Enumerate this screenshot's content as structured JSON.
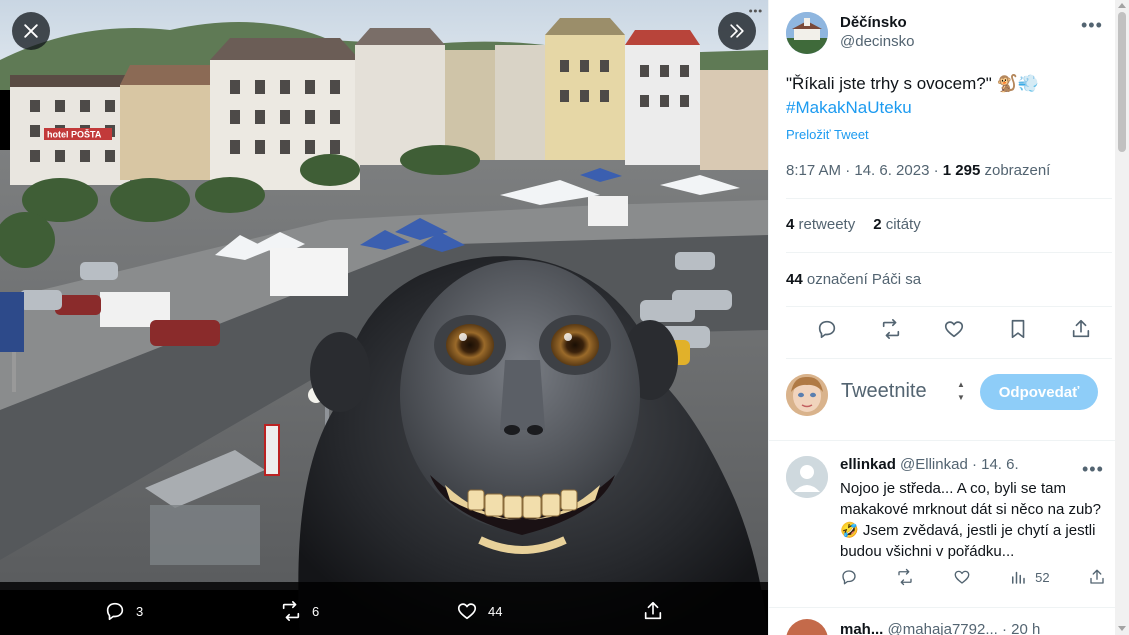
{
  "media": {
    "actions": {
      "replies": "3",
      "retweets": "6",
      "likes": "44"
    },
    "icons": [
      "close-icon",
      "double-chevron-right-icon",
      "reply-icon",
      "retweet-icon",
      "like-icon",
      "share-icon"
    ],
    "signs": {
      "hotel": "hotel POŠTA"
    }
  },
  "tweet": {
    "author_name": "Děčínsko",
    "author_handle": "@decinsko",
    "text": "\"Říkali jste trhy s ovocem?\" 🐒💨",
    "hashtag": "#MakakNaUteku",
    "translate": "Preložiť Tweet",
    "time": "8:17 AM · 14. 6. 2023 · ",
    "views_count": "1 295",
    "views_label": " zobrazení",
    "retweets_count": "4",
    "retweets_label": " retweety",
    "quotes_count": "2",
    "quotes_label": " citáty",
    "likes_count": "44",
    "likes_label": " označení Páči sa"
  },
  "reply_box": {
    "placeholder": "Tweetnite",
    "button": "Odpovedať"
  },
  "replies": [
    {
      "name": "ellinkad",
      "handle": "@Ellinkad",
      "date": " · 14. 6.",
      "text": "Nojoo je středa... A co, byli se tam makakové mrknout dát si něco na zub? 🤣 Jsem zvědavá, jestli je chytí a jestli budou všichni v pořádku...",
      "views": "52"
    },
    {
      "name": "mah...",
      "handle": "@mahaja7792...",
      "date": " · 20 h"
    }
  ],
  "colors": {
    "accent": "#1d9bf0",
    "reply_button": "#8ecdf8",
    "muted_text": "#536471"
  }
}
